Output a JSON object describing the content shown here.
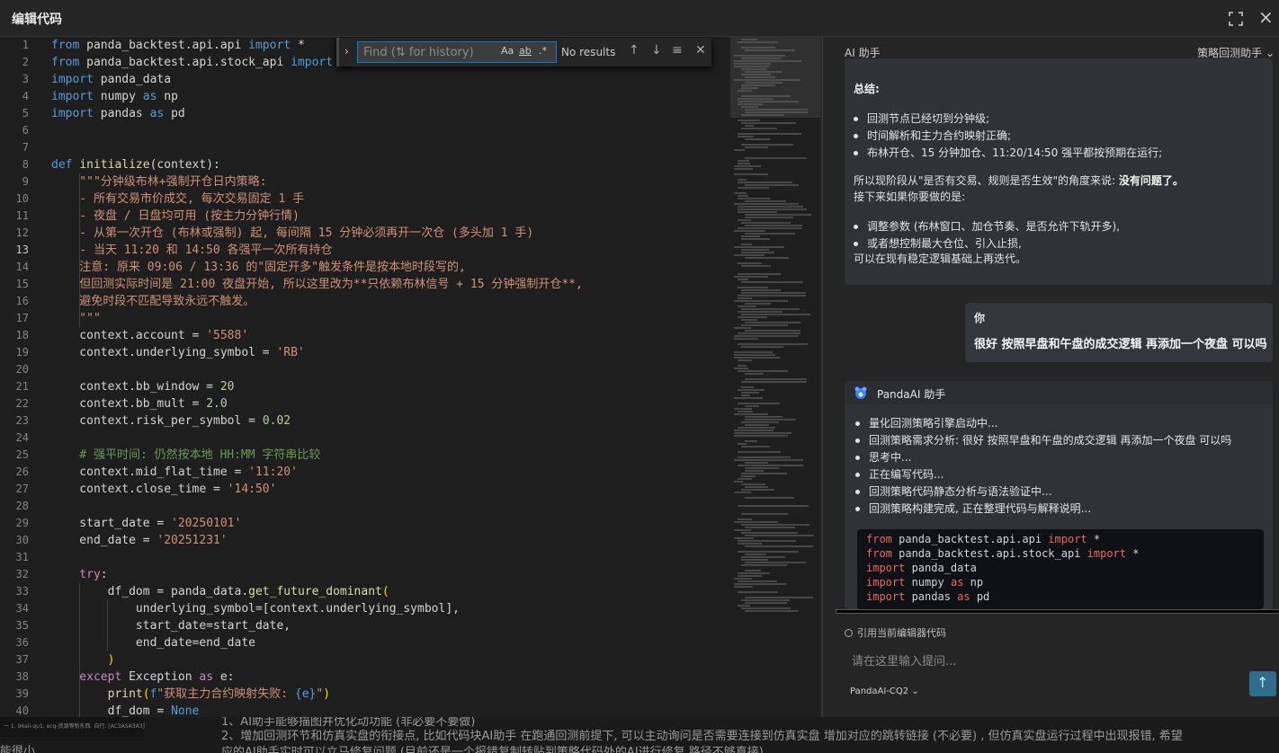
{
  "window": {
    "title": "编辑代码"
  },
  "find_widget": {
    "placeholder": "Find (⇅ for history)",
    "match_case": "Aa",
    "match_word": "ab",
    "regex": ".*",
    "result": "No results"
  },
  "editor": {
    "active_line": 13,
    "lines": [
      [
        [
          "k",
          "from"
        ],
        [
          "t",
          " panda_backtest.api.api "
        ],
        [
          "k",
          "import"
        ],
        [
          "t",
          " *"
        ]
      ],
      [
        [
          "k",
          "from"
        ],
        [
          "t",
          " panda_backtest.api.stock_api "
        ],
        [
          "k",
          "import"
        ]
      ],
      [
        [
          "k",
          "import"
        ],
        [
          "t",
          " panda_data"
        ]
      ],
      [
        [
          "k",
          "import"
        ],
        [
          "t",
          " numpy "
        ],
        [
          "k",
          "as"
        ],
        [
          "t",
          " np"
        ]
      ],
      [
        [
          "k",
          "import"
        ],
        [
          "t",
          " pandas "
        ],
        [
          "k",
          "as"
        ],
        [
          "t",
          " pd"
        ]
      ],
      [],
      [],
      [
        [
          "k",
          "def"
        ],
        [
          "t",
          " "
        ],
        [
          "f",
          "initialize"
        ],
        [
          "t",
          "(context):"
        ]
      ],
      [
        [
          "s",
          "    \"\"\"分钟级布林+强制开仓日内策略:"
        ]
      ],
      [
        [
          "s",
          "    - 所有交易市价成交, 每次交易固定 1 手"
        ]
      ],
      [
        [
          "s",
          "    - 夜盘 / 日盘均可用 (按主力分钟行情)"
        ]
      ],
      [
        [
          "s",
          "    - 从第一次开仓 (布林或强制) 起, 每间隔 15 分钟必须再开一次仓 (多头加 1 手)"
        ]
      ],
      [
        [
          "s",
          "    - 当天 11:20 和 14:50 各强平一次所有持仓"
        ]
      ],
      [
        [
          "s",
          "    注意: 原来 09:06 / 13:36 的\"固定开多\"触发条件是按本地时段写的,"
        ]
      ],
      [
        [
          "s",
          "    但回测实际时间是 21:00 夜盘开始, 所以这里改为**只依赖布林信号 + 15 分钟强制开仓**,"
        ]
      ],
      [
        [
          "s",
          "    避免时段不匹配导致永远不触发。"
        ]
      ],
      [
        [
          "s",
          "    \"\"\""
        ]
      ],
      [
        [
          "t",
          "    context.account = "
        ],
        [
          "s",
          "'5588'"
        ]
      ],
      [
        [
          "t",
          "    context.underlying_symbol = "
        ],
        [
          "s",
          "'RB'"
        ]
      ],
      [],
      [
        [
          "t",
          "    context.bb_window = "
        ],
        [
          "n",
          "20"
        ]
      ],
      [
        [
          "t",
          "    context.bb_mult = "
        ],
        [
          "n",
          "2.0"
        ]
      ],
      [
        [
          "t",
          "    context.risk_per_symbol = "
        ],
        [
          "n",
          "0.02"
        ]
      ],
      [],
      [
        [
          "c",
          "    # 强平时间: 仍然按本地 HH:MM 字符串比较"
        ]
      ],
      [
        [
          "t",
          "    context.mid_flat_time = "
        ],
        [
          "s",
          "'11:20'"
        ]
      ],
      [
        [
          "t",
          "    context.close_time = "
        ],
        [
          "s",
          "'14:50'"
        ]
      ],
      [],
      [
        [
          "t",
          "    start_date = "
        ],
        [
          "s",
          "'20250101'"
        ]
      ],
      [
        [
          "t",
          "    end_date = "
        ],
        [
          "s",
          "'20251231'"
        ]
      ],
      [],
      [
        [
          "kc",
          "    try"
        ],
        [
          "t",
          ":"
        ]
      ],
      [
        [
          "t",
          "        df_dom = panda_data."
        ],
        [
          "f",
          "get_future_dominant"
        ],
        [
          "p",
          "("
        ]
      ],
      [
        [
          "t",
          "            underlying_symbol=["
        ],
        [
          "t",
          "context.underlying_symbol"
        ],
        [
          "t",
          "],"
        ]
      ],
      [
        [
          "t",
          "            start_date=start_date,"
        ]
      ],
      [
        [
          "t",
          "            end_date=end_date"
        ]
      ],
      [
        [
          "p",
          "        )"
        ]
      ],
      [
        [
          "kc",
          "    except"
        ],
        [
          "t",
          " Exception "
        ],
        [
          "kc",
          "as"
        ],
        [
          "t",
          " e:"
        ]
      ],
      [
        [
          "t",
          "        "
        ],
        [
          "f",
          "print"
        ],
        [
          "p",
          "("
        ],
        [
          "k",
          "f"
        ],
        [
          "s",
          "\"获取主力合约映射失败: "
        ],
        [
          "k",
          "{e}"
        ],
        [
          "s",
          "\""
        ],
        [
          "p",
          ")"
        ]
      ],
      [
        [
          "t",
          "        df_dom = "
        ],
        [
          "k",
          "None"
        ]
      ]
    ]
  },
  "ai_panel": {
    "title": "AI 助手",
    "mode": "策略回测助手",
    "prev_message": {
      "summary_label": "总结:",
      "bullets1": [
        "回测节点已经切到分钟级;",
        "时间解析和主力合约映射正确;",
        "布林开仓、15 分钟加仓、11:20/14:50 强平都按预期在运行;"
      ],
      "para_prefix": "所以现阶段从\"是否有交易、规则是否生效\"的角度来说: ",
      "para_bold": "没有问题了。",
      "next_line": "接下来如果你要做的是:",
      "bullets2": [
        "调整参数 (布林窗口、加仓节奏、是否允许下轨开多),",
        "或者想控制最大仓位、引入止损,"
      ],
      "closing": "可以在现有稳定逻辑基础上再迭代。"
    },
    "user_message": {
      "author": "你",
      "text": "很好 按照早盘和午盘的成交逻辑 再添加一个夜盘 可以吗"
    },
    "bot_message": {
      "author": "PandaAI 助手",
      "steps": [
        "量化回测策略引擎启动中...",
        "回测策略需求分析: 很好 按照早盘和午盘的成交逻辑 再添加一个夜盘 可以吗",
        "思考中...",
        "正在编写代码...",
        "回测策略代码静态分析与语法验证中...",
        "回测策略构建完成, 正在整理代码与解释说明..."
      ],
      "code": [
        [
          [
            "kw",
            "from"
          ],
          [
            "t",
            " panda_backtest.api.api "
          ],
          [
            "kw",
            "import"
          ],
          [
            "t",
            " *"
          ]
        ],
        [
          [
            "kw",
            "from"
          ],
          [
            "t",
            " panda_backtest.api.stock_api "
          ],
          [
            "kw",
            "import"
          ],
          [
            "t",
            " *"
          ]
        ],
        [
          [
            "kw",
            "import"
          ],
          [
            "t",
            " panda_data"
          ]
        ],
        [
          [
            "kw",
            "import"
          ],
          [
            "t",
            " numpy "
          ],
          [
            "kw",
            "as"
          ],
          [
            "t",
            " np"
          ]
        ],
        [
          [
            "kw",
            "import"
          ],
          [
            "t",
            " pandas "
          ],
          [
            "kw",
            "as"
          ],
          [
            "t",
            " pd"
          ]
        ]
      ]
    },
    "cite_label": "引用当前编辑器代码",
    "input_placeholder": "请在这里输入提问...",
    "model": "PandaAI-CQ2"
  },
  "bottom": {
    "thumb_text": "一 1, 96ali-qu1, ecq-资源等新东西. 自行: [AC3ASA3A3]",
    "line1": "1、AI助手能够描图并优化动功能 (非必要不要做)",
    "line2": "2、增加回测环节和仿真实盘的衔接点, 比如代码块AI助手 在跑通回测前提下, 可以主动询问是否需要连接到仿真实盘 增加对应的跳转链接 (不必要) , 但仿真实盘运行过程中出现报错, 希望",
    "line3": "应的AI助手实时可以立马修复问题 (目前还是一个报错复制转贴到策略代码处的AI进行修复 路径不够直接)",
    "side": "能很小"
  }
}
